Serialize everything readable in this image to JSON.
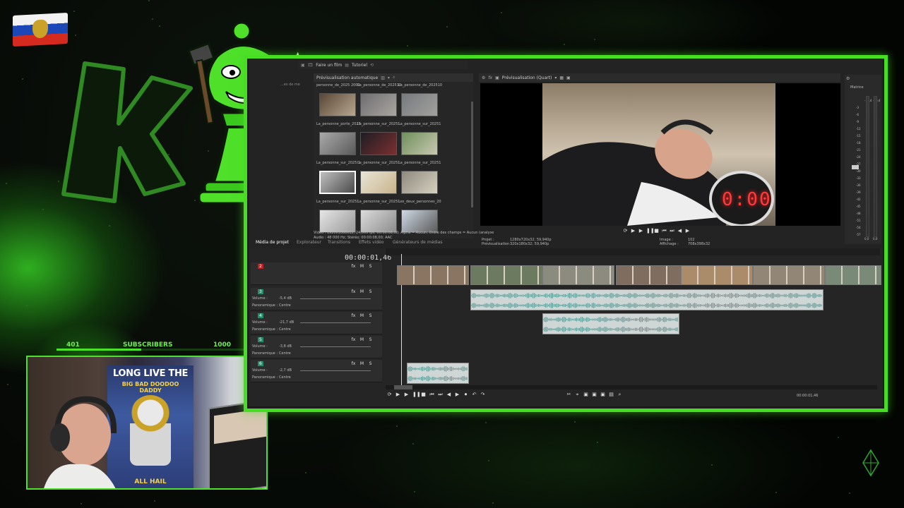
{
  "overlay": {
    "subscriber_current": "401",
    "subscriber_label": "SUBSCRIBERS",
    "subscriber_goal": "1000",
    "subscriber_progress": 0.401,
    "accent_color": "#46dd22",
    "poster_title": "LONG LIVE THE",
    "poster_subtitle": "BIG BAD DOODOO DADDY",
    "poster_footer": "ALL HAIL"
  },
  "editor": {
    "menu": {
      "make_film": "Faire un film",
      "tutorial": "Tutoriel"
    },
    "media_panel": {
      "toolbar_label": "Prévisualisation automatique",
      "items": [
        {
          "label": "personne_de_2025 200040.mp4"
        },
        {
          "label": "La_personne_de_202510 200045.mp4"
        },
        {
          "label": "La_personne_de_202510 200048.mp4"
        },
        {
          "label": "La_personne_porte_2025 10192328.mp4"
        },
        {
          "label": "La_personne_sur_20251 0191909_2.mp4"
        },
        {
          "label": "La_personne_sur_20251 0191925.mp4"
        },
        {
          "label": "La_personne_sur_2025 10191925.mp4"
        },
        {
          "label": "La_personne_sur_20251 0192239.mp4"
        },
        {
          "label": "La_personne_sur_20251 0192240.mp4"
        },
        {
          "label": "La_personne_sur_20251 0192311.mp4"
        },
        {
          "label": "La_personne_sur_20251 0192311_1.mp4"
        },
        {
          "label": "Les_deux_personnes_20 2510192301.mp4"
        }
      ],
      "info_video": "Vidéo : 1920x1088x12; 24,000 ips; 00:00:08,00; Alpha = Aucun; Ordre des champs = Aucun (analyse",
      "info_audio": "Audio : 48 000 Hz; Stéréo; 00:00:08,00; AAC",
      "tabs": [
        "Média de projet",
        "Explorateur",
        "Transitions",
        "Effets vidéo",
        "Générateurs de médias"
      ]
    },
    "preview": {
      "toolbar_label": "Prévisualisation (Quart)",
      "clock_display": "0:00",
      "project_label": "Projet :",
      "project_value": "1280x720x32; 59,940p",
      "preview_label": "Prévisualisation :",
      "preview_value": "320x180x32; 59,940p",
      "image_label": "Image :",
      "image_value": "102",
      "display_label": "Affichage :",
      "display_value": "708x398x32"
    },
    "master": {
      "label": "Matrice",
      "ticks": [
        "-3",
        "-6",
        "-9",
        "-12",
        "-15",
        "-18",
        "-21",
        "-24",
        "-27",
        "-30",
        "-33",
        "-36",
        "-39",
        "-42",
        "-45",
        "-48",
        "-51",
        "-54",
        "-57"
      ],
      "top_values": [
        "-10,4",
        "-10,4"
      ],
      "bottom_values": [
        "0,0",
        "0,0"
      ]
    },
    "timeline": {
      "timecode": "00:00:01,46",
      "tracks": [
        {
          "number": "2",
          "type": "video"
        },
        {
          "number": "3",
          "volume_label": "Volume :",
          "volume": "-5,4 dB",
          "pan_label": "Panoramique :",
          "pan": "Centre"
        },
        {
          "number": "4",
          "volume_label": "Volume :",
          "volume": "-21,7 dB",
          "pan_label": "Panoramique :",
          "pan": "Centre"
        },
        {
          "number": "5",
          "volume_label": "Volume :",
          "volume": "-3,8 dB",
          "pan_label": "Panoramique :",
          "pan": "Centre"
        },
        {
          "number": "6",
          "volume_label": "Volume :",
          "volume": "-2,7 dB",
          "pan_label": "Panoramique :",
          "pan": "Centre"
        }
      ],
      "bottom_timecode": "00:00:01,46"
    }
  }
}
